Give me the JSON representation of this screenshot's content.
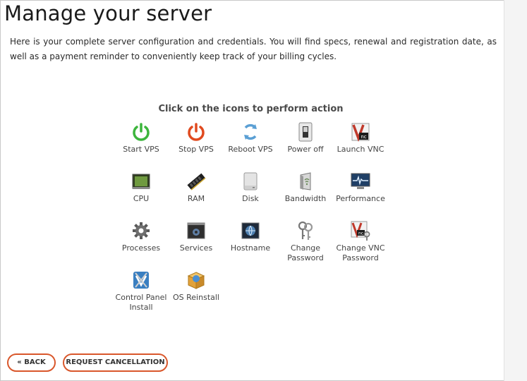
{
  "page": {
    "title": "Manage your server",
    "intro": "Here is your complete server configuration and credentials. You will find specs, renewal and registration date, as well as a payment reminder to conveniently keep track of your billing cycles."
  },
  "actions": {
    "heading": "Click on the icons to perform action",
    "items": [
      {
        "label": "Start VPS",
        "icon": "power-on-icon",
        "color": "#3cb53c"
      },
      {
        "label": "Stop VPS",
        "icon": "power-off-icon",
        "color": "#e04a1f"
      },
      {
        "label": "Reboot VPS",
        "icon": "reboot-icon",
        "color": "#5a9fd4"
      },
      {
        "label": "Power off",
        "icon": "power-switch-icon",
        "color": "#888888"
      },
      {
        "label": "Launch VNC",
        "icon": "vnc-icon",
        "color": "#c0392b"
      },
      {
        "label": "CPU",
        "icon": "cpu-icon",
        "color": "#4f7a32"
      },
      {
        "label": "RAM",
        "icon": "ram-icon",
        "color": "#222222"
      },
      {
        "label": "Disk",
        "icon": "disk-icon",
        "color": "#b8b8b8"
      },
      {
        "label": "Bandwidth",
        "icon": "bandwidth-icon",
        "color": "#6a8a5a"
      },
      {
        "label": "Performance",
        "icon": "performance-icon",
        "color": "#2a5f8f"
      },
      {
        "label": "Processes",
        "icon": "processes-gear-icon",
        "color": "#555555"
      },
      {
        "label": "Services",
        "icon": "services-icon",
        "color": "#333333"
      },
      {
        "label": "Hostname",
        "icon": "hostname-icon",
        "color": "#2c4a6e"
      },
      {
        "label": "Change Password",
        "icon": "keys-icon",
        "color": "#777777"
      },
      {
        "label": "Change VNC Password",
        "icon": "vnc-key-icon",
        "color": "#c0392b"
      },
      {
        "label": "Control Panel Install",
        "icon": "control-panel-icon",
        "color": "#3a7fc1"
      },
      {
        "label": "OS Reinstall",
        "icon": "os-reinstall-icon",
        "color": "#e2a23a"
      }
    ]
  },
  "buttons": {
    "back": "« BACK",
    "cancel": "REQUEST CANCELLATION",
    "accent": "#d9572b"
  }
}
